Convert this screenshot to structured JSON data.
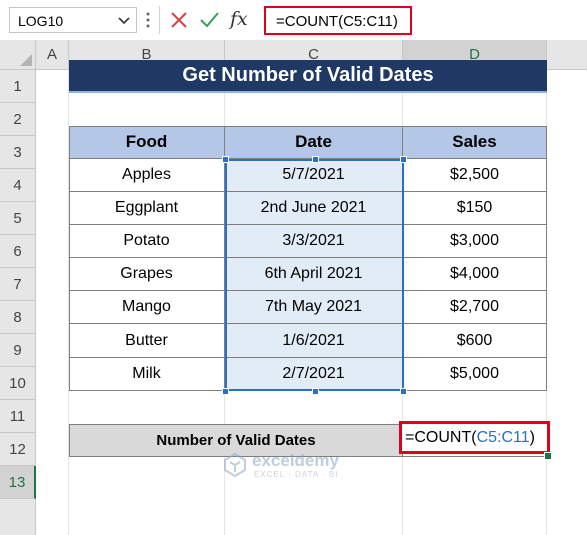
{
  "formula_bar": {
    "name_box": "LOG10",
    "formula": "=COUNT(C5:C11)",
    "fx_label": "fx",
    "icons": {
      "cancel": "close-x-icon",
      "enter": "check-icon",
      "insert_function": "fx-icon",
      "dropdown": "chevron-down-icon"
    }
  },
  "columns": [
    "A",
    "B",
    "C",
    "D"
  ],
  "selected_column": "D",
  "rows": [
    "1",
    "2",
    "3",
    "4",
    "5",
    "6",
    "7",
    "8",
    "9",
    "10",
    "11",
    "12",
    "13"
  ],
  "selected_row": "13",
  "title": "Get Number of Valid Dates",
  "table": {
    "headers": [
      "Food",
      "Date",
      "Sales"
    ],
    "rows": [
      [
        "Apples",
        "5/7/2021",
        "$2,500"
      ],
      [
        "Eggplant",
        "2nd June 2021",
        "$150"
      ],
      [
        "Potato",
        "3/3/2021",
        "$3,000"
      ],
      [
        "Grapes",
        "6th April 2021",
        "$4,000"
      ],
      [
        "Mango",
        "7th May 2021",
        "$2,700"
      ],
      [
        "Butter",
        "1/6/2021",
        "$600"
      ],
      [
        "Milk",
        "2/7/2021",
        "$5,000"
      ]
    ]
  },
  "summary": {
    "label": "Number of Valid Dates",
    "formula_prefix": "=COUNT(",
    "formula_ref": "C5:C11",
    "formula_suffix": ")"
  },
  "watermark": {
    "name": "exceldemy",
    "tagline": "EXCEL · DATA · BI",
    "icon": "exceldemy-logo-icon"
  },
  "colors": {
    "title_bg": "#203864",
    "header_bg": "#b4c7e7",
    "highlight_red": "#e0001b",
    "range_blue": "#2b6fc7",
    "excel_green": "#217346"
  }
}
